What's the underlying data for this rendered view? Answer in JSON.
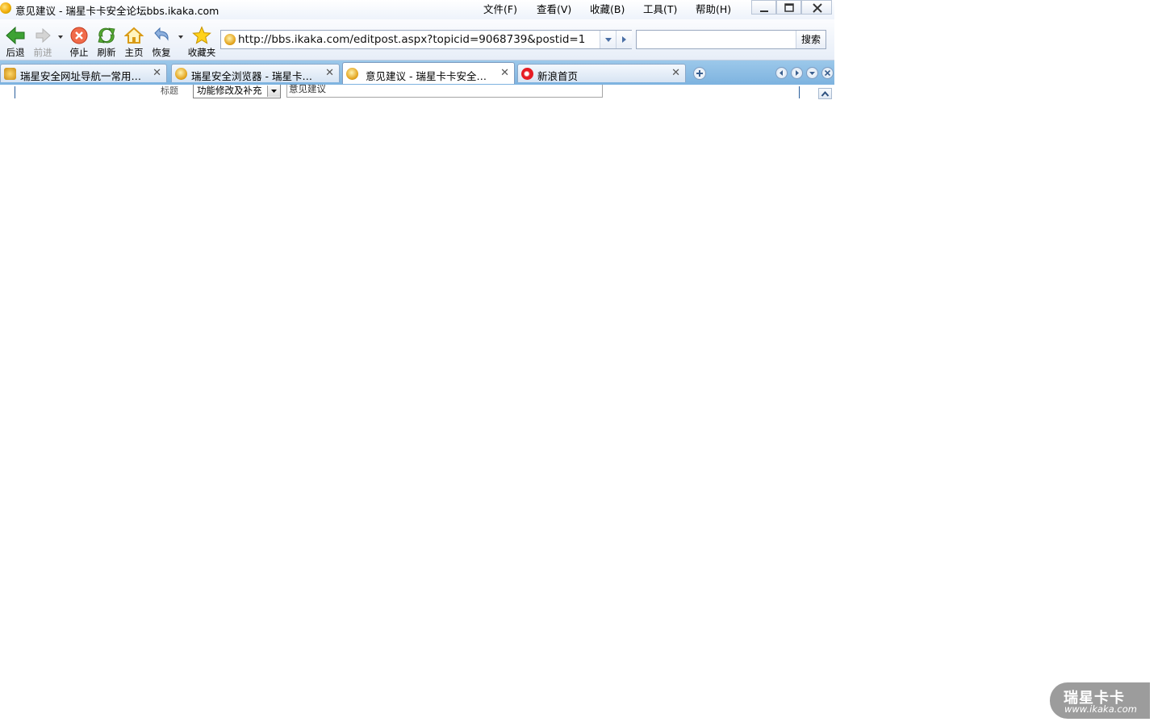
{
  "window": {
    "title": "意见建议 - 瑞星卡卡安全论坛bbs.ikaka.com",
    "menu": [
      "文件(F)",
      "查看(V)",
      "收藏(B)",
      "工具(T)",
      "帮助(H)"
    ]
  },
  "toolbar": {
    "back_label": "后退",
    "forward_label": "前进",
    "stop_label": "停止",
    "refresh_label": "刷新",
    "home_label": "主页",
    "restore_label": "恢复",
    "favorites_label": "收藏夹",
    "address_url": "http://bbs.ikaka.com/editpost.aspx?topicid=9068739&postid=1",
    "search_button": "搜索",
    "search_value": ""
  },
  "tabs": [
    {
      "label": "瑞星安全网址导航一常用…",
      "active": false
    },
    {
      "label": "瑞星安全浏览器 - 瑞星卡…",
      "active": false
    },
    {
      "label": "意见建议 - 瑞星卡卡安全…",
      "active": true
    },
    {
      "label": "新浪首页",
      "active": false
    }
  ],
  "form": {
    "title_label": "标题",
    "category_selected": "功能修改及补充",
    "title_value": "意见建议"
  },
  "watermark": {
    "brand": "瑞星卡卡",
    "url": "www.ikaka.com"
  },
  "colors": {
    "tabbar": "#8dbce4",
    "accent": "#2b5f9c"
  }
}
